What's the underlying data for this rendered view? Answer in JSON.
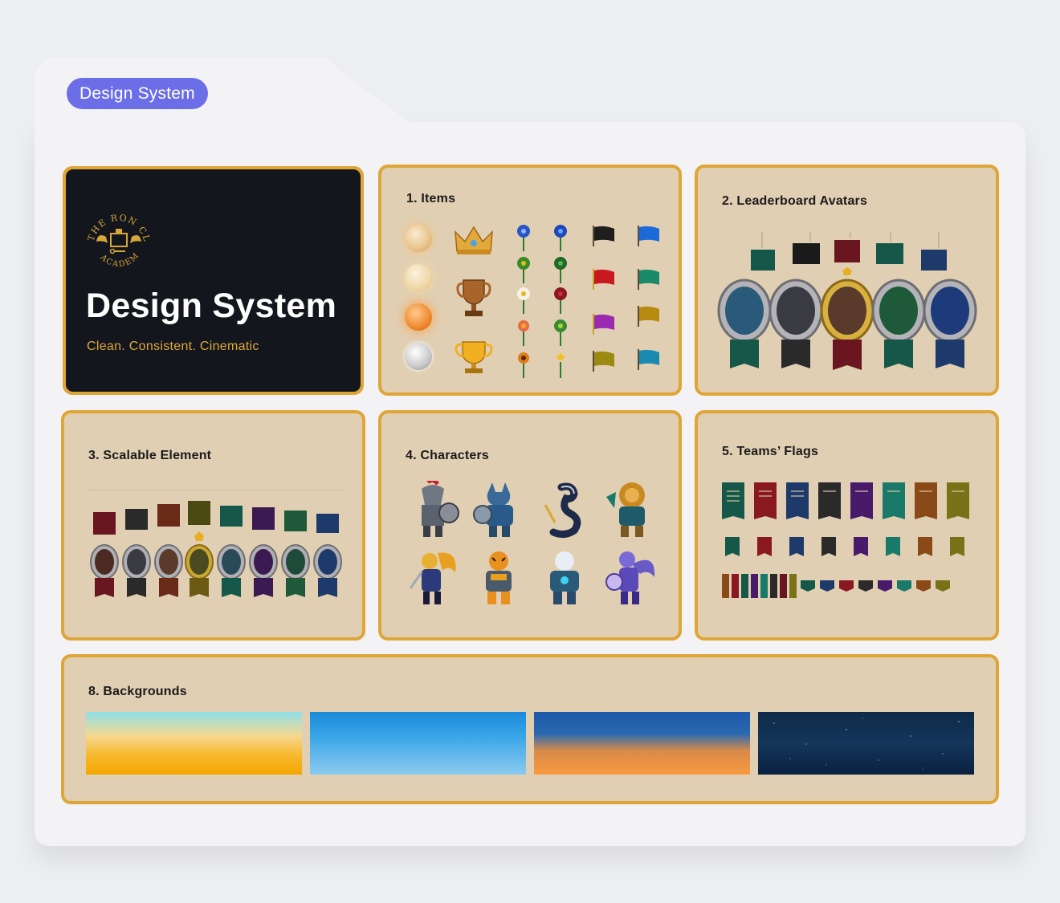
{
  "header": {
    "pill_label": "Design System"
  },
  "hero": {
    "logo_text": "THE RON CLARK ACADEMY",
    "title": "Design System",
    "subtitle": "Clean. Consistent. Cinematic"
  },
  "sections": {
    "items": "1. Items",
    "leaderboard": "2. Leaderboard Avatars",
    "scalable": "3. Scalable Element",
    "characters": "4. Characters",
    "flags": "5. Teams’ Flags",
    "backgrounds": "8. Backgrounds"
  },
  "colors": {
    "accent": "#6b6ee6",
    "border": "#dea537",
    "card": "#e1cfb3",
    "hero_bg": "#13171d",
    "gold_text": "#e0a838"
  }
}
